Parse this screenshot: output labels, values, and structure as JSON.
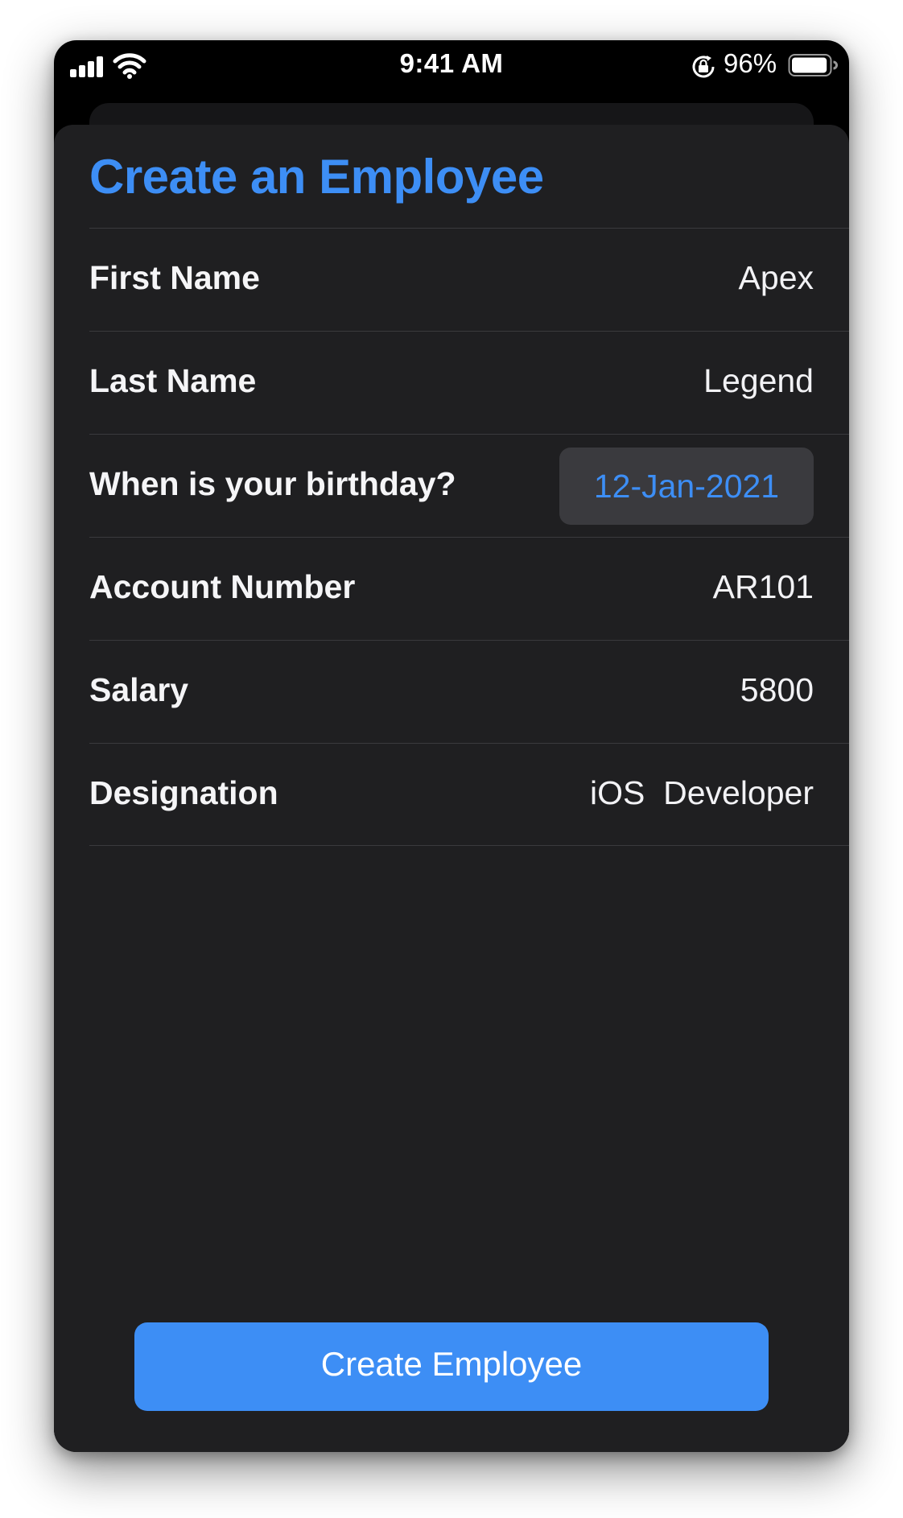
{
  "status_bar": {
    "time": "9:41 AM",
    "battery_percent": "96%",
    "battery_level": 0.96,
    "signal_bars": 4,
    "icons": [
      "cellular-signal-icon",
      "wifi-icon",
      "orientation-lock-icon",
      "battery-icon"
    ]
  },
  "form": {
    "title": "Create an Employee",
    "fields": [
      {
        "label": "First Name",
        "value": "Apex"
      },
      {
        "label": "Last Name",
        "value": "Legend"
      },
      {
        "label": "When is your birthday?",
        "value": "12-Jan-2021"
      },
      {
        "label": "Account Number",
        "value": "AR101"
      },
      {
        "label": "Salary",
        "value": "5800"
      },
      {
        "label": "Designation",
        "value": "iOS  Developer"
      }
    ]
  },
  "actions": {
    "create_label": "Create Employee"
  },
  "colors": {
    "accent": "#3d8ef5",
    "sheet_background": "#1f1f21",
    "separator": "#3a3a3d",
    "date_pill": "#3a3a3e"
  }
}
